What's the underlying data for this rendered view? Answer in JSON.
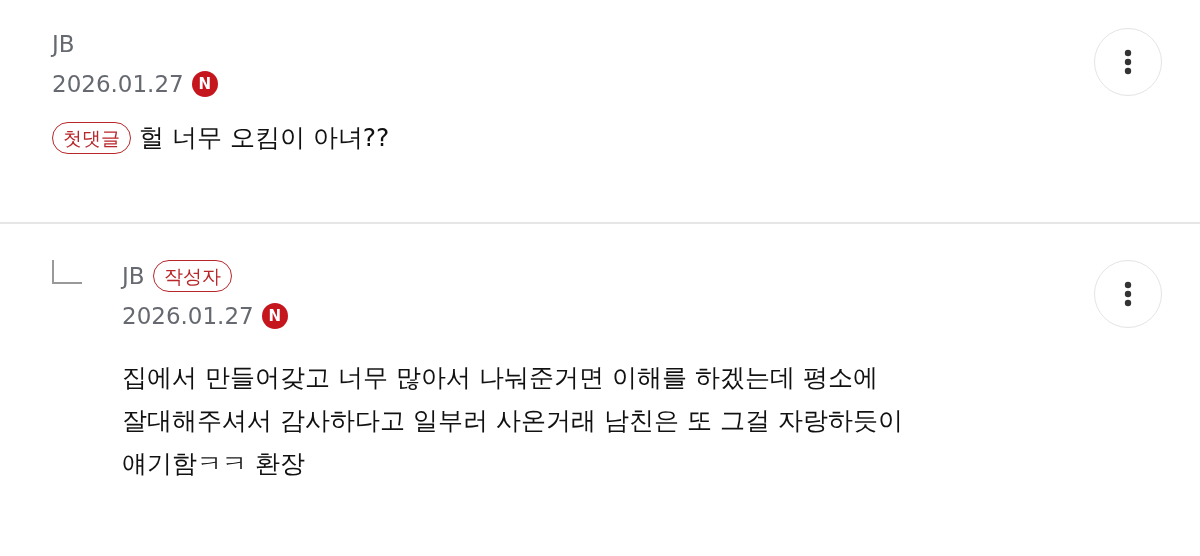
{
  "comments": [
    {
      "kind": "comment",
      "author": "JB",
      "date": "2026.01.27",
      "new_badge": "N",
      "body_tag": "첫댓글",
      "lines": [
        "헐 너무 오킴이 아녀??"
      ]
    },
    {
      "kind": "reply",
      "author": "JB",
      "author_tag": "작성자",
      "date": "2026.01.27",
      "new_badge": "N",
      "lines": [
        "집에서 만들어갖고 너무 많아서 나눠준거면 이해를 하겠는데 평소에",
        "잘대해주셔서 감사하다고 일부러 사온거래 남친은 또 그걸 자랑하듯이",
        "얘기함ㅋㅋ 환장"
      ]
    }
  ]
}
